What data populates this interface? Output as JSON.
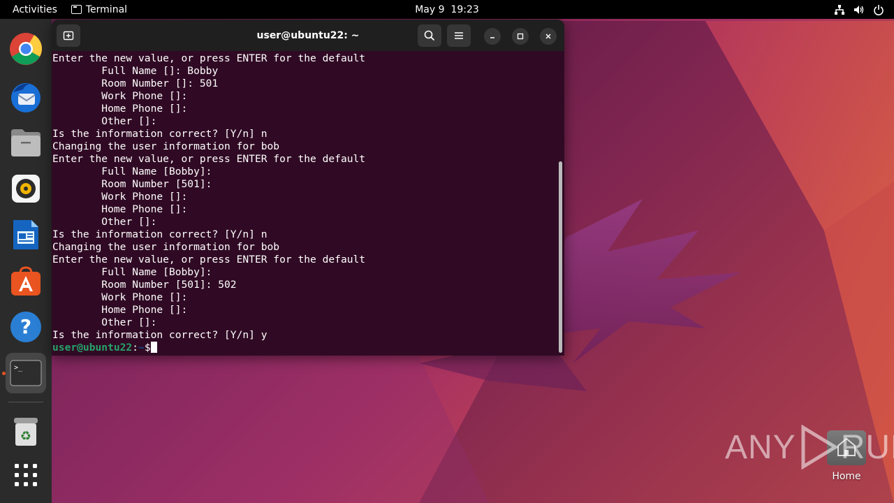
{
  "topbar": {
    "activities": "Activities",
    "app_name": "Terminal",
    "date": "May 9",
    "time": "19:23"
  },
  "dock": {
    "items": [
      {
        "name": "Google Chrome"
      },
      {
        "name": "Thunderbird"
      },
      {
        "name": "Files"
      },
      {
        "name": "Rhythmbox"
      },
      {
        "name": "LibreOffice Writer"
      },
      {
        "name": "Ubuntu Software"
      },
      {
        "name": "Help"
      },
      {
        "name": "Terminal"
      },
      {
        "name": "Trash"
      },
      {
        "name": "Show Applications"
      }
    ]
  },
  "terminal": {
    "title": "user@ubuntu22: ~",
    "lines": [
      "Enter the new value, or press ENTER for the default",
      "\tFull Name []: Bobby",
      "\tRoom Number []: 501",
      "\tWork Phone []:",
      "\tHome Phone []:",
      "\tOther []:",
      "Is the information correct? [Y/n] n",
      "Changing the user information for bob",
      "Enter the new value, or press ENTER for the default",
      "\tFull Name [Bobby]:",
      "\tRoom Number [501]:",
      "\tWork Phone []:",
      "\tHome Phone []:",
      "\tOther []:",
      "Is the information correct? [Y/n] n",
      "Changing the user information for bob",
      "Enter the new value, or press ENTER for the default",
      "\tFull Name [Bobby]:",
      "\tRoom Number [501]: 502",
      "\tWork Phone []:",
      "\tHome Phone []:",
      "\tOther []:",
      "Is the information correct? [Y/n] y"
    ],
    "prompt_user": "user@ubuntu22",
    "prompt_sep": ":",
    "prompt_path": "~",
    "prompt_symbol": "$"
  },
  "desktop": {
    "home_label": "Home"
  },
  "watermark": {
    "text_left": "ANY",
    "text_right": "RUN"
  }
}
